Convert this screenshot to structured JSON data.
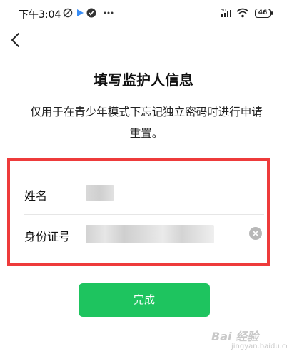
{
  "status_bar": {
    "time": "下午3:04",
    "battery": "46",
    "network": "HD"
  },
  "header": {
    "back_icon": "chevron-left-icon"
  },
  "main": {
    "title": "填写监护人信息",
    "description": "仅用于在青少年模式下忘记独立密码时进行申请重置。"
  },
  "form": {
    "fields": [
      {
        "label": "姓名"
      },
      {
        "label": "身份证号"
      }
    ],
    "clear_icon": "clear-icon"
  },
  "actions": {
    "done_label": "完成"
  },
  "watermark": {
    "text": "Bai 经验",
    "sub": "jingyan.baidu.com"
  },
  "colors": {
    "accent": "#1ec45f",
    "highlight": "#ee3b3b"
  }
}
